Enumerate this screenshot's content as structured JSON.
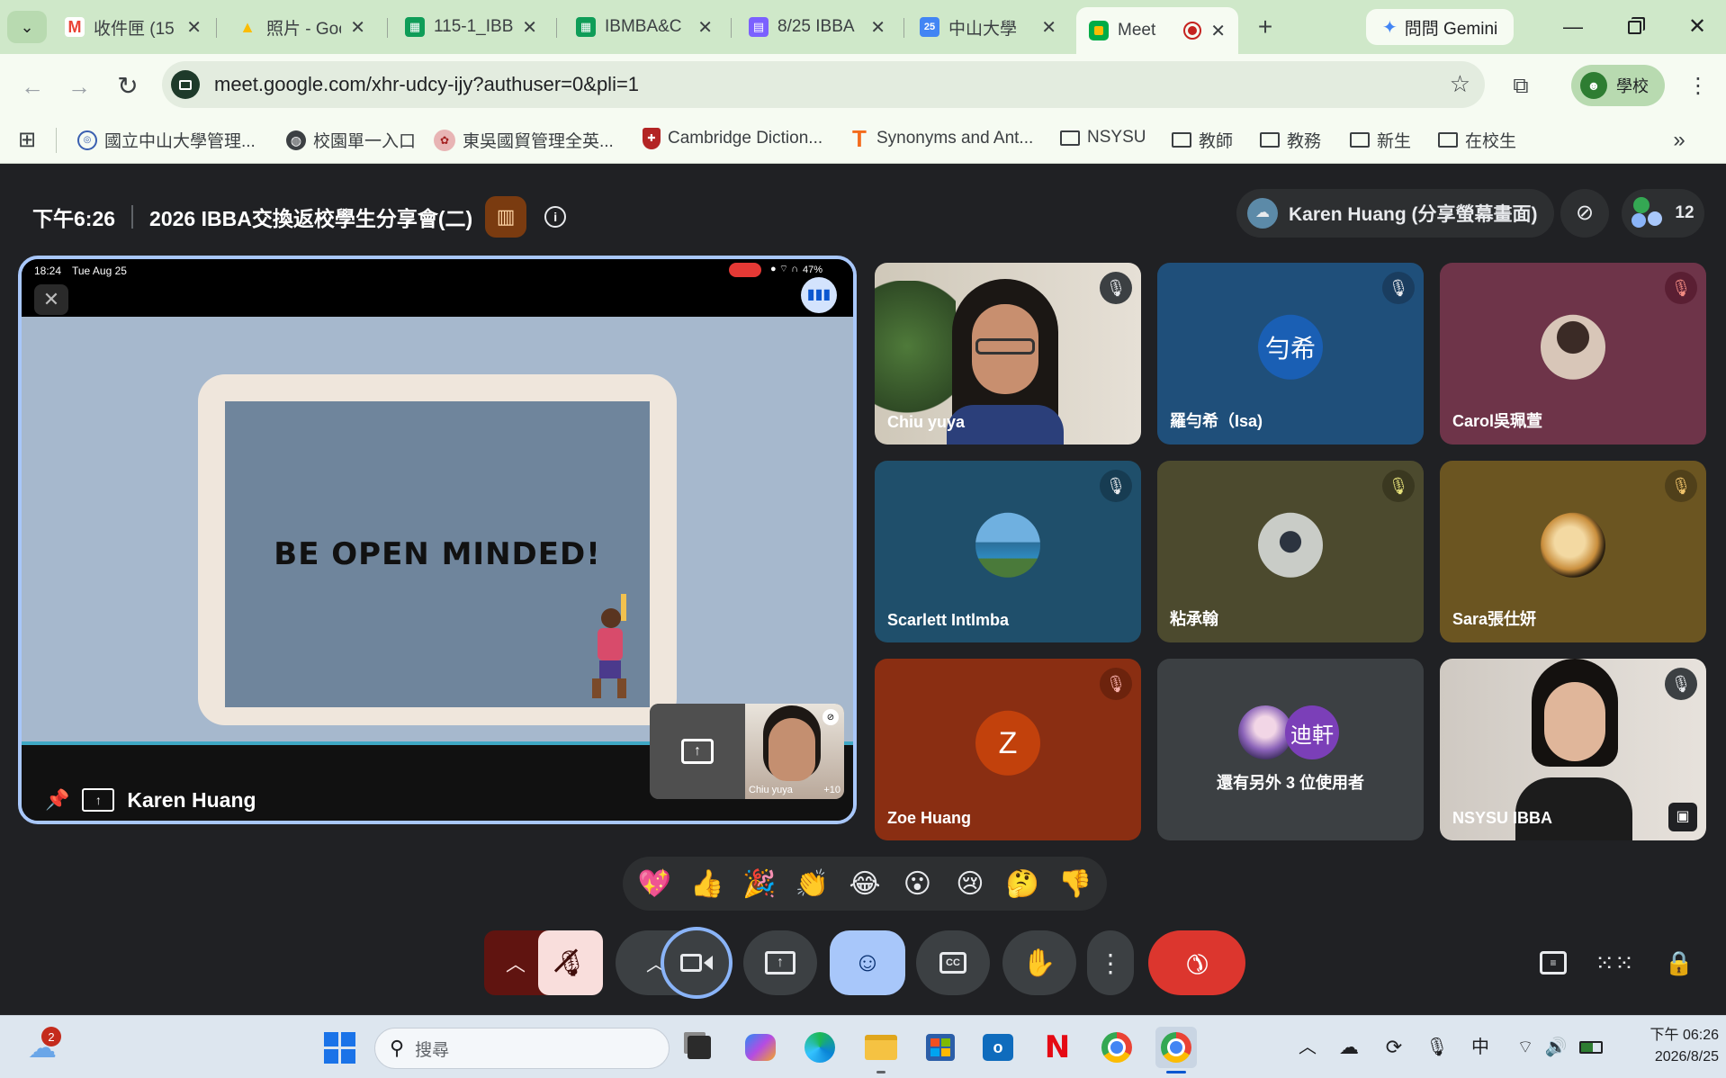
{
  "browser": {
    "tabs": [
      {
        "label": "收件匣 (15",
        "icon": "gmail-icon",
        "color": "#ea4335",
        "glyph": "M"
      },
      {
        "label": "照片 - Goo",
        "icon": "google-drive-icon",
        "color": "#fbbc04",
        "glyph": "▲"
      },
      {
        "label": "115-1_IBB",
        "icon": "sheets-icon",
        "color": "#0f9d58",
        "glyph": "▦"
      },
      {
        "label": "IBMBA&C",
        "icon": "sheets-icon",
        "color": "#0f9d58",
        "glyph": "▦"
      },
      {
        "label": "8/25 IBBA",
        "icon": "forms-icon",
        "color": "#7b61ff",
        "glyph": "▤"
      },
      {
        "label": "中山大學",
        "icon": "calendar-icon",
        "color": "#4285f4",
        "glyph": "25"
      },
      {
        "label": "Meet",
        "icon": "meet-icon",
        "color": "#00ac47",
        "glyph": "■",
        "active": true
      }
    ],
    "gemini_button": "問問 Gemini",
    "url": "meet.google.com/xhr-udcy-ijy?authuser=0&pli=1",
    "profile_label": "學校",
    "bookmarks": [
      {
        "label": "國立中山大學管理...",
        "type": "site"
      },
      {
        "label": "校園單一入口",
        "type": "globe"
      },
      {
        "label": "東吳國貿管理全英...",
        "type": "site"
      },
      {
        "label": "Cambridge Diction...",
        "type": "site"
      },
      {
        "label": "Synonyms and Ant...",
        "type": "site"
      },
      {
        "label": "NSYSU",
        "type": "folder"
      },
      {
        "label": "教師",
        "type": "folder"
      },
      {
        "label": "教務",
        "type": "folder"
      },
      {
        "label": "新生",
        "type": "folder"
      },
      {
        "label": "在校生",
        "type": "folder"
      }
    ]
  },
  "meet": {
    "time": "下午6:26",
    "meeting_title": "2026 IBBA交換返校學生分享會(二)",
    "presenter_chip": "Karen Huang (分享螢幕畫面)",
    "participant_count": "12",
    "presentation": {
      "status_time": "18:24",
      "status_date": "Tue Aug 25",
      "battery": "47%",
      "slide_text": "BE OPEN MINDED!",
      "presenter_name": "Karen Huang",
      "self_view_name": "Chiu yuya",
      "more_count": "+10"
    },
    "participants": [
      {
        "name": "Chiu yuya",
        "type": "photo",
        "bg": "#c9c1b2"
      },
      {
        "name": "羅勻希（Isa)",
        "type": "initials",
        "initials": "勻希",
        "bg": "#1f4f7a",
        "avatar_bg": "#1a5fb4"
      },
      {
        "name": "Carol吳珮萱",
        "type": "image",
        "bg": "#6e3449"
      },
      {
        "name": "Scarlett Intlmba",
        "type": "image",
        "bg": "#1f4f6b"
      },
      {
        "name": "粘承翰",
        "type": "image",
        "bg": "#4c4a2e"
      },
      {
        "name": "Sara張仕妍",
        "type": "image",
        "bg": "#6b5521"
      },
      {
        "name": "Zoe Huang",
        "type": "initials",
        "initials": "Z",
        "bg": "#8a2e12",
        "avatar_bg": "#c2410c"
      },
      {
        "name": "還有另外 3 位使用者",
        "type": "more",
        "avatar_text": "迪軒",
        "bg": "#3c4043"
      },
      {
        "name": "NSYSU IBBA",
        "type": "photo",
        "bg": "#d9d4cf"
      }
    ],
    "reactions": [
      "💖",
      "👍",
      "🎉",
      "👏",
      "😂",
      "😮",
      "😢",
      "🤔",
      "👎"
    ]
  },
  "taskbar": {
    "search_placeholder": "搜尋",
    "weather_badge": "2",
    "ime": "中",
    "time": "下午 06:26",
    "date": "2026/8/25"
  }
}
